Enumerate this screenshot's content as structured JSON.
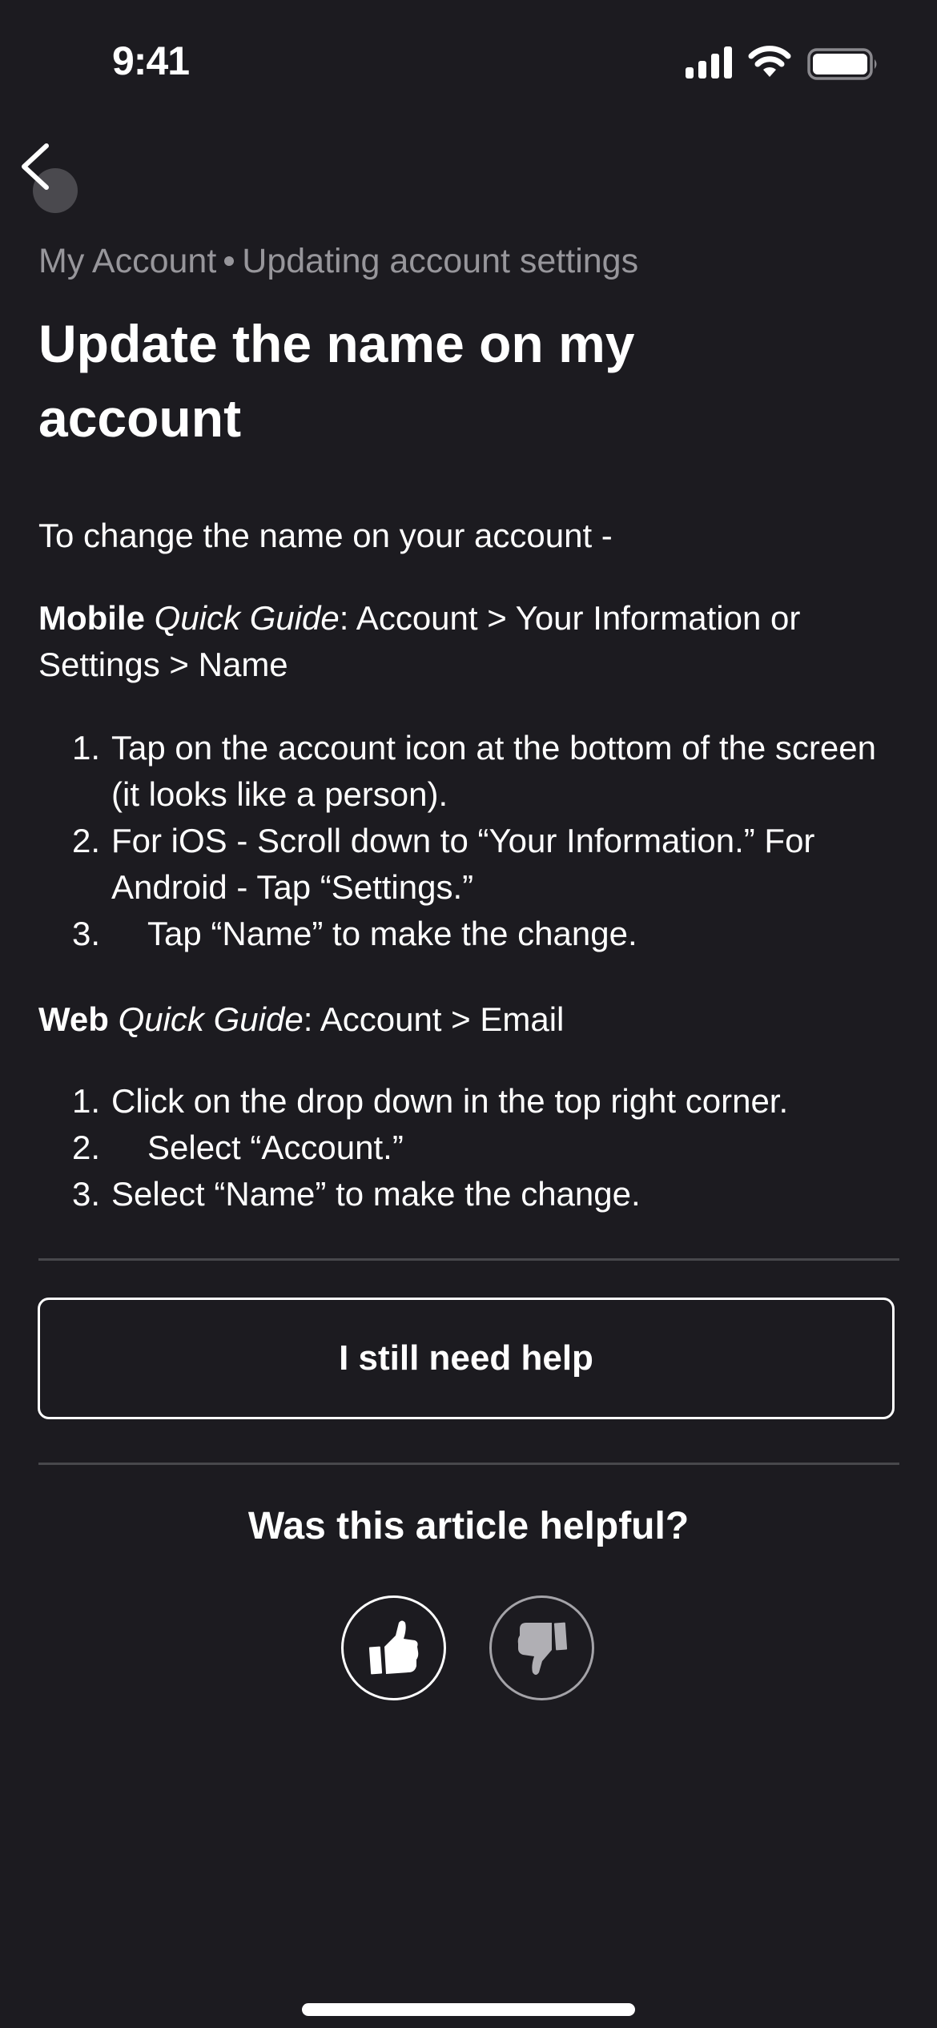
{
  "status_bar": {
    "time": "9:41",
    "icons": [
      "cellular-signal-icon",
      "wifi-icon",
      "battery-icon"
    ]
  },
  "nav": {
    "back_icon": "chevron-left-icon"
  },
  "breadcrumb": {
    "items": [
      "My Account",
      "Updating account settings"
    ],
    "separator": "•"
  },
  "article": {
    "title": "Update the name on my account",
    "intro": "To change the name on your account -",
    "mobile_guide": {
      "platform": "Mobile",
      "label": "Quick Guide",
      "path": ": Account > Your Information or Settings > Name",
      "steps": [
        {
          "num": "1.",
          "text": "Tap on the account icon at the bottom of the screen (it looks like a person)."
        },
        {
          "num": "2.",
          "text": "For iOS - Scroll down to “Your Information.” For Android - Tap  “Settings.”"
        },
        {
          "num": "3.",
          "text": "Tap “Name” to make the change."
        }
      ]
    },
    "web_guide": {
      "platform": "Web",
      "label": "Quick Guide",
      "path": ": Account > Email",
      "steps": [
        {
          "num": "1.",
          "text": "Click on the drop down in the top right corner."
        },
        {
          "num": "2.",
          "text": "Select “Account.”"
        },
        {
          "num": "3.",
          "text": "Select “Name” to make the change."
        }
      ]
    }
  },
  "help_button": {
    "label": "I still need help"
  },
  "feedback": {
    "question": "Was this article helpful?",
    "thumbs_up_icon": "thumbs-up-icon",
    "thumbs_down_icon": "thumbs-down-icon"
  },
  "colors": {
    "background": "#1c1b20",
    "text": "#ffffff",
    "muted_text": "#97969b",
    "divider": "#48484c",
    "thumbs_down": "#b0afb4"
  }
}
